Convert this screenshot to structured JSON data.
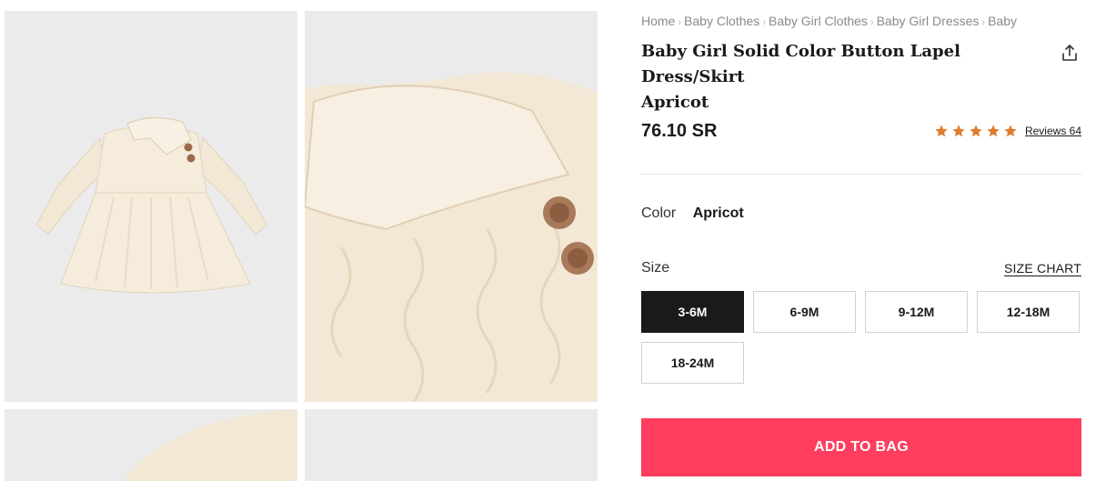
{
  "breadcrumb": [
    "Home",
    "Baby Clothes",
    "Baby Girl Clothes",
    "Baby Girl Dresses",
    "Baby"
  ],
  "product": {
    "title_line1": "Baby Girl Solid Color Button Lapel Dress/Skirt",
    "title_line2": "Apricot",
    "price": "76.10 SR",
    "rating_stars": 5,
    "reviews_label": "Reviews 64"
  },
  "color": {
    "label": "Color",
    "value": "Apricot"
  },
  "size": {
    "label": "Size",
    "chart_label": "SIZE CHART",
    "options": [
      "3-6M",
      "6-9M",
      "9-12M",
      "12-18M",
      "18-24M"
    ],
    "selected": "3-6M"
  },
  "actions": {
    "add_to_bag": "ADD TO BAG"
  },
  "icons": {
    "share": "share-icon",
    "star": "star-icon"
  },
  "colors": {
    "accent": "#ff3d5e",
    "star": "#e07b2a",
    "selected_bg": "#1a1a1a",
    "fabric": "#f3e8d6"
  }
}
